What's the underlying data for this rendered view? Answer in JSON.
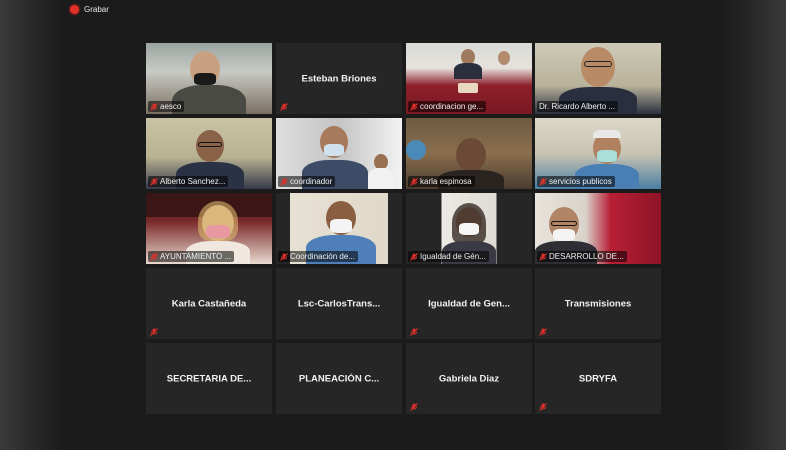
{
  "app": {
    "record_label": "Grabar",
    "record_icon": "record-dot-icon"
  },
  "colors": {
    "active_speaker_border": "#b8e04a",
    "muted_icon": "#e0302a",
    "tile_background": "#262626"
  },
  "participants": [
    {
      "name": "aesco",
      "video": true,
      "muted": true
    },
    {
      "name": "Esteban Briones",
      "video": false,
      "muted": true
    },
    {
      "name": "coordinacion ge...",
      "video": true,
      "muted": true
    },
    {
      "name": "Dr. Ricardo Alberto ...",
      "video": true,
      "muted": false,
      "active": true
    },
    {
      "name": "Alberto Sanchez...",
      "video": true,
      "muted": true
    },
    {
      "name": "coordinador",
      "video": true,
      "muted": true
    },
    {
      "name": "karla espinosa",
      "video": true,
      "muted": true
    },
    {
      "name": "servicios publicos",
      "video": true,
      "muted": true
    },
    {
      "name": "AYUNTAMIENTO ...",
      "video": true,
      "muted": true
    },
    {
      "name": "Coordinación de...",
      "video": true,
      "muted": true
    },
    {
      "name": "Igualdad de Gén...",
      "video": true,
      "muted": true
    },
    {
      "name": "DESARROLLO DE...",
      "video": true,
      "muted": true
    },
    {
      "name": "Karla Castañeda",
      "video": false,
      "muted": true
    },
    {
      "name": "Lsc-CarlosTrans...",
      "video": false,
      "muted": false
    },
    {
      "name": "Igualdad de Gen...",
      "video": false,
      "muted": true
    },
    {
      "name": "Transmisiones",
      "video": false,
      "muted": true
    },
    {
      "name": "SECRETARIA DE...",
      "video": false,
      "muted": false
    },
    {
      "name": "PLANEACIÓN C...",
      "video": false,
      "muted": false
    },
    {
      "name": "Gabriela Diaz",
      "video": false,
      "muted": true
    },
    {
      "name": "SDRYFA",
      "video": false,
      "muted": true
    }
  ]
}
